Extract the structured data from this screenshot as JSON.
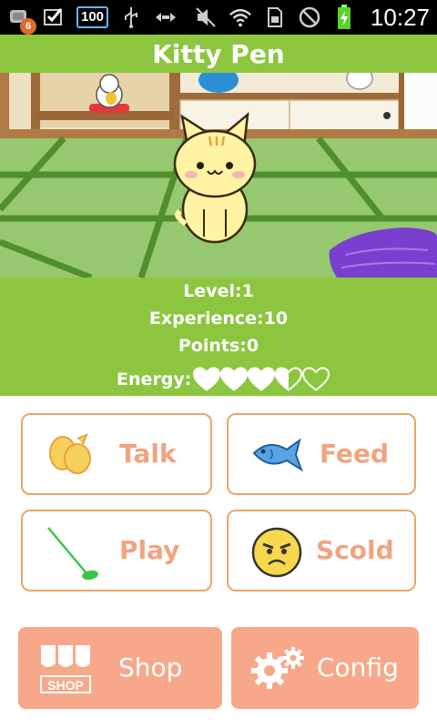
{
  "status_bar": {
    "notification_count": "6",
    "battery_level_box": "100",
    "time": "10:27"
  },
  "app": {
    "title": "Kitty Pen"
  },
  "stats": {
    "level": "Level:1",
    "experience": "Experience:10",
    "points": "Points:0",
    "energy_label": "Energy:",
    "energy_hearts": 3.5,
    "energy_max": 5
  },
  "actions": {
    "talk": "Talk",
    "feed": "Feed",
    "play": "Play",
    "scold": "Scold"
  },
  "bottom": {
    "shop": "Shop",
    "shop_logo_text": "SHOP",
    "config": "Config"
  },
  "colors": {
    "green": "#8cc63f",
    "button_border": "#e8a66a",
    "button_text": "#f0a480",
    "bottom_button": "#f8a88a"
  }
}
